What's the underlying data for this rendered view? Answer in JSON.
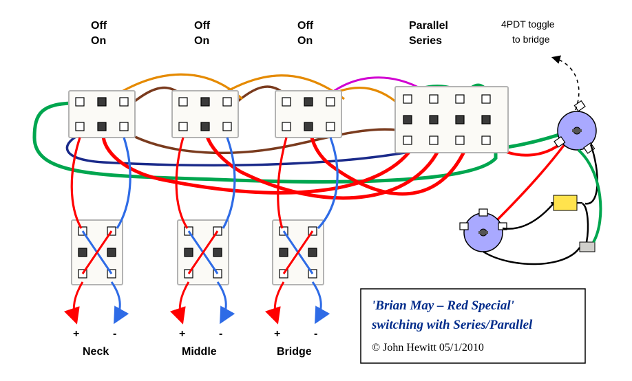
{
  "title": "'Brian May – Red Special'",
  "subtitle": "switching with Series/Parallel",
  "copyright": "© John Hewitt 05/1/2010",
  "switches_top": [
    {
      "off": "Off",
      "on": "On"
    },
    {
      "off": "Off",
      "on": "On"
    },
    {
      "off": "Off",
      "on": "On"
    }
  ],
  "series_parallel": {
    "top": "Parallel",
    "bottom": "Series"
  },
  "toggle_note": {
    "line1": "4PDT toggle",
    "line2": "to bridge"
  },
  "pickups": [
    {
      "name": "Neck",
      "plus": "+",
      "minus": "-"
    },
    {
      "name": "Middle",
      "plus": "+",
      "minus": "-"
    },
    {
      "name": "Bridge",
      "plus": "+",
      "minus": "-"
    }
  ],
  "colors": {
    "red": "#ff0000",
    "blue": "#2e6be6",
    "green": "#00a64f",
    "orange": "#e58a00",
    "brown": "#7a3b1e",
    "navy": "#1a2a8a",
    "magenta": "#d100d1",
    "black": "#000000"
  },
  "chart_data": {
    "type": "diagram",
    "description": "Guitar wiring diagram: Brian May Red Special switching with Series/Parallel mod",
    "components": {
      "onoff_switches": [
        {
          "id": "SW1",
          "type": "DPDT-on-off",
          "labels": [
            "Off",
            "On"
          ],
          "pickup": "Neck"
        },
        {
          "id": "SW2",
          "type": "DPDT-on-off",
          "labels": [
            "Off",
            "On"
          ],
          "pickup": "Middle"
        },
        {
          "id": "SW3",
          "type": "DPDT-on-off",
          "labels": [
            "Off",
            "On"
          ],
          "pickup": "Bridge"
        }
      ],
      "phase_switches": [
        {
          "id": "PH1",
          "type": "DPDT-phase",
          "pickup": "Neck"
        },
        {
          "id": "PH2",
          "type": "DPDT-phase",
          "pickup": "Middle"
        },
        {
          "id": "PH3",
          "type": "DPDT-phase",
          "pickup": "Bridge"
        }
      ],
      "series_parallel_switch": {
        "id": "SP",
        "type": "4PDT",
        "labels": [
          "Parallel",
          "Series"
        ]
      },
      "pots": [
        {
          "id": "VOL",
          "type": "potentiometer",
          "role": "volume"
        },
        {
          "id": "TONE",
          "type": "potentiometer",
          "role": "tone",
          "cap": true
        }
      ],
      "output_jack": true,
      "ground_plate": true
    },
    "wires": [
      {
        "from": "PH1.hot",
        "to": "SW1.in.hot",
        "color": "red"
      },
      {
        "from": "PH1.cold",
        "to": "SW1.in.cold",
        "color": "blue"
      },
      {
        "from": "PH2.hot",
        "to": "SW2.in.hot",
        "color": "red"
      },
      {
        "from": "PH2.cold",
        "to": "SW2.in.cold",
        "color": "blue"
      },
      {
        "from": "PH3.hot",
        "to": "SW3.in.hot",
        "color": "red"
      },
      {
        "from": "PH3.cold",
        "to": "SW3.in.cold",
        "color": "blue"
      },
      {
        "from": "SW1.out",
        "to": "SP.p1",
        "color": "green"
      },
      {
        "from": "SW2.out",
        "to": "SP.p2",
        "color": "orange"
      },
      {
        "from": "SW3.out",
        "to": "SP.p3",
        "color": "magenta"
      },
      {
        "from": "SW1.bus",
        "to": "SW2.bus",
        "color": "brown"
      },
      {
        "from": "SW2.bus",
        "to": "SW3.bus",
        "color": "brown"
      },
      {
        "from": "SW3.bus",
        "to": "SP.common",
        "color": "brown"
      },
      {
        "from": "SW1.gnd",
        "to": "SP.gnd",
        "color": "navy"
      },
      {
        "from": "SP.series1",
        "to": "SW1.ret",
        "color": "red"
      },
      {
        "from": "SP.series2",
        "to": "SW2.ret",
        "color": "red"
      },
      {
        "from": "SP.series3",
        "to": "SW3.ret",
        "color": "red"
      },
      {
        "from": "SP.out",
        "to": "VOL.in",
        "color": "green"
      },
      {
        "from": "VOL.wiper",
        "to": "TONE",
        "color": "red"
      },
      {
        "from": "VOL.out",
        "to": "JACK.tip",
        "color": "green"
      },
      {
        "from": "TONE.cap",
        "to": "GND",
        "color": "black"
      },
      {
        "from": "VOL.gnd",
        "to": "GND",
        "color": "black"
      }
    ]
  }
}
